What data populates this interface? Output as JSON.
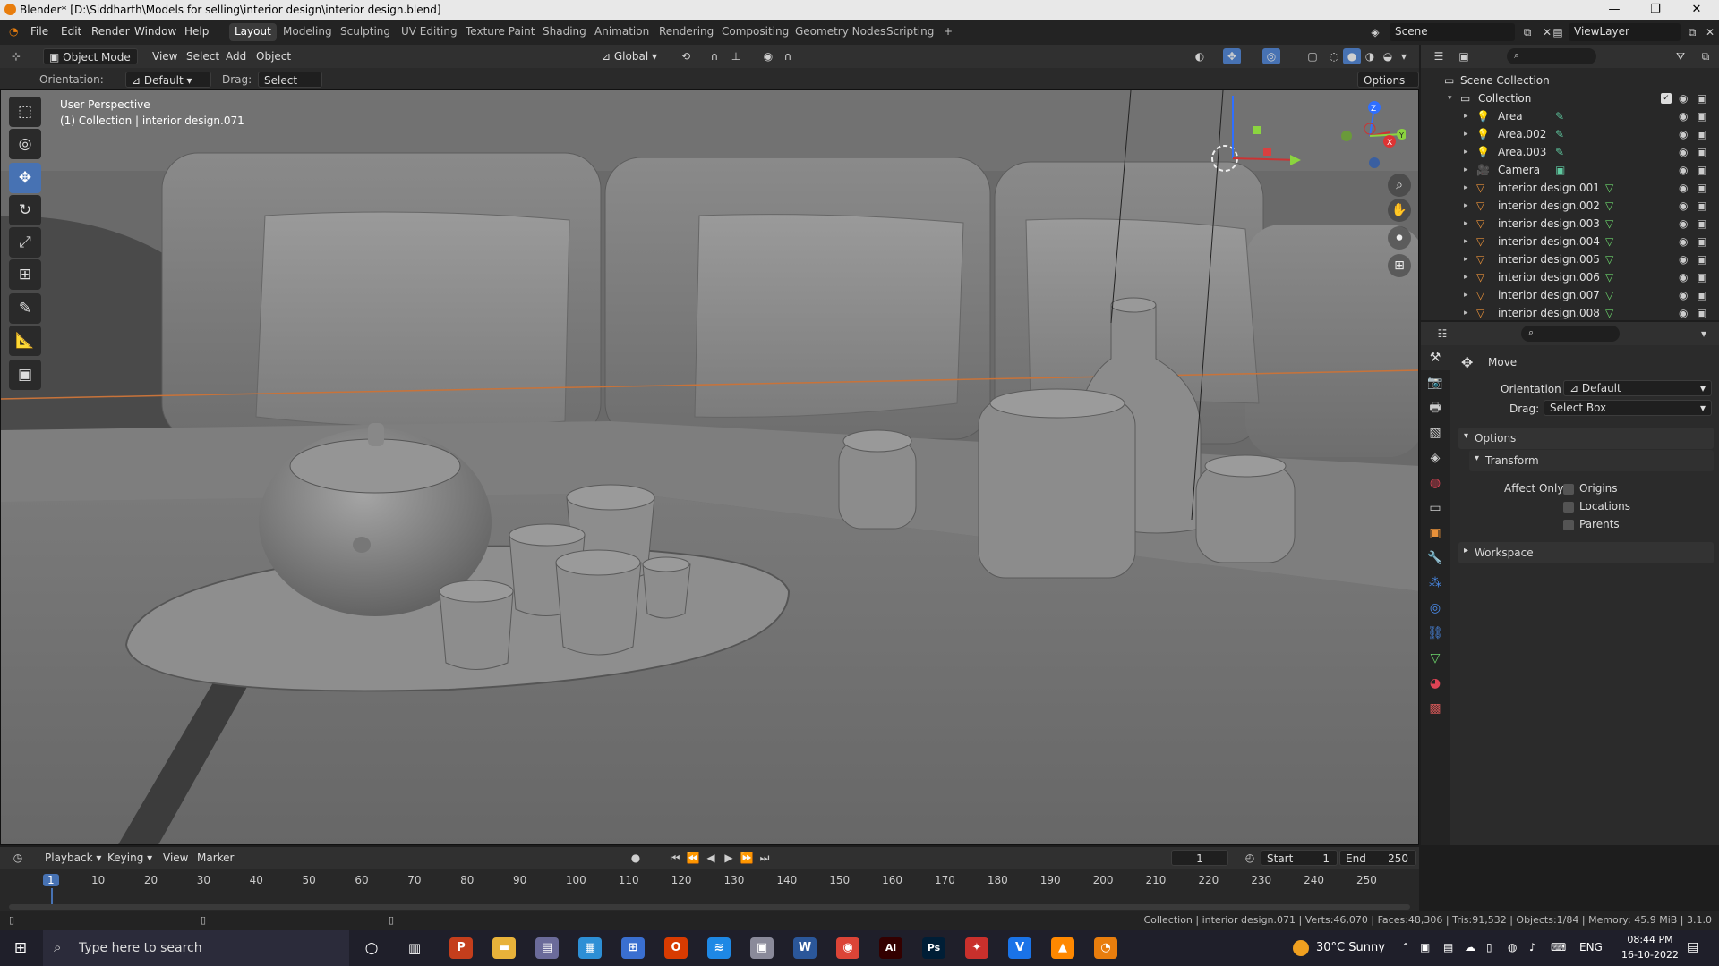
{
  "window": {
    "title": "Blender* [D:\\Siddharth\\Models for selling\\interior design\\interior design.blend]",
    "minimize": "—",
    "restore": "❐",
    "close": "✕"
  },
  "menu": {
    "items": [
      "File",
      "Edit",
      "Render",
      "Window",
      "Help"
    ]
  },
  "workspaces": {
    "tabs": [
      "Layout",
      "Modeling",
      "Sculpting",
      "UV Editing",
      "Texture Paint",
      "Shading",
      "Animation",
      "Rendering",
      "Compositing",
      "Geometry Nodes",
      "Scripting"
    ],
    "active": "Layout",
    "add": "+"
  },
  "scene": {
    "name": "Scene",
    "view_layer": "ViewLayer"
  },
  "viewport_header": {
    "mode": "Object Mode",
    "menus": [
      "View",
      "Select",
      "Add",
      "Object"
    ],
    "transform_orientation": "Global"
  },
  "toolsettings": {
    "orientation_label": "Orientation:",
    "orientation_value": "Default",
    "drag_label": "Drag:",
    "drag_value": "Select Box",
    "options": "Options"
  },
  "viewport": {
    "perspective": "User Perspective",
    "collection_info": "(1) Collection | interior design.071",
    "gizmo": {
      "x": "X",
      "y": "Y",
      "z": "Z"
    }
  },
  "tools": [
    {
      "name": "select-box-tool",
      "glyph": "⬚"
    },
    {
      "name": "cursor-tool",
      "glyph": "◎"
    },
    {
      "name": "move-tool",
      "glyph": "✥"
    },
    {
      "name": "rotate-tool",
      "glyph": "↻"
    },
    {
      "name": "scale-tool",
      "glyph": "⤢"
    },
    {
      "name": "transform-tool",
      "glyph": "⊞"
    },
    {
      "name": "annotate-tool",
      "glyph": "✎"
    },
    {
      "name": "measure-tool",
      "glyph": "📐"
    },
    {
      "name": "add-cube-tool",
      "glyph": "▣"
    }
  ],
  "outliner": {
    "root": "Scene Collection",
    "collection": "Collection",
    "items": [
      {
        "label": "Area",
        "type": "light"
      },
      {
        "label": "Area.002",
        "type": "light"
      },
      {
        "label": "Area.003",
        "type": "light"
      },
      {
        "label": "Camera",
        "type": "camera"
      },
      {
        "label": "interior design.001",
        "type": "mesh"
      },
      {
        "label": "interior design.002",
        "type": "mesh"
      },
      {
        "label": "interior design.003",
        "type": "mesh"
      },
      {
        "label": "interior design.004",
        "type": "mesh"
      },
      {
        "label": "interior design.005",
        "type": "mesh"
      },
      {
        "label": "interior design.006",
        "type": "mesh"
      },
      {
        "label": "interior design.007",
        "type": "mesh"
      },
      {
        "label": "interior design.008",
        "type": "mesh"
      }
    ]
  },
  "properties": {
    "tool_name": "Move",
    "orientation_label": "Orientation",
    "orientation_value": "Default",
    "drag_label": "Drag:",
    "drag_value": "Select Box",
    "options_panel": "Options",
    "transform_panel": "Transform",
    "affect_only_label": "Affect Only",
    "affect_only": [
      "Origins",
      "Locations",
      "Parents"
    ],
    "workspace_panel": "Workspace"
  },
  "timeline": {
    "menus": [
      "Playback",
      "Keying",
      "View",
      "Marker"
    ],
    "current_frame": "1",
    "start_label": "Start",
    "start": "1",
    "end_label": "End",
    "end": "250",
    "ticks": [
      "1",
      "10",
      "20",
      "30",
      "40",
      "50",
      "60",
      "70",
      "80",
      "90",
      "100",
      "110",
      "120",
      "130",
      "140",
      "150",
      "160",
      "170",
      "180",
      "190",
      "200",
      "210",
      "220",
      "230",
      "240",
      "250"
    ]
  },
  "statusbar": {
    "text": "Collection | interior design.071 | Verts:46,070 | Faces:48,306 | Tris:91,532 | Objects:1/84 | Memory: 45.9 MiB | 3.1.0"
  },
  "taskbar": {
    "search_placeholder": "Type here to search",
    "weather": "30°C  Sunny",
    "lang": "ENG",
    "time": "08:44 PM",
    "date": "16-10-2022",
    "apps": [
      {
        "name": "powerpoint-icon",
        "glyph": "P",
        "color": "#c43e1c"
      },
      {
        "name": "file-explorer-icon",
        "glyph": "▬",
        "color": "#e8b23a"
      },
      {
        "name": "app-icon-1",
        "glyph": "▤",
        "color": "#6b6b9a"
      },
      {
        "name": "app-icon-2",
        "glyph": "▦",
        "color": "#2d8fd5"
      },
      {
        "name": "store-icon",
        "glyph": "⊞",
        "color": "#3a6fd0"
      },
      {
        "name": "office-icon",
        "glyph": "O",
        "color": "#d83b01"
      },
      {
        "name": "app-icon-3",
        "glyph": "≋",
        "color": "#1e88e5"
      },
      {
        "name": "app-icon-4",
        "glyph": "▣",
        "color": "#8a8a9a"
      },
      {
        "name": "word-icon",
        "glyph": "W",
        "color": "#2b579a"
      },
      {
        "name": "chrome-icon",
        "glyph": "◉",
        "color": "#db4437"
      },
      {
        "name": "illustrator-icon",
        "glyph": "Ai",
        "color": "#330000"
      },
      {
        "name": "photoshop-icon",
        "glyph": "Ps",
        "color": "#001e36"
      },
      {
        "name": "app-icon-5",
        "glyph": "✦",
        "color": "#c9302c"
      },
      {
        "name": "vectorworks-icon",
        "glyph": "V",
        "color": "#1a73e8"
      },
      {
        "name": "vlc-icon",
        "glyph": "▲",
        "color": "#ff8800"
      },
      {
        "name": "blender-taskbar-icon",
        "glyph": "◔",
        "color": "#e87d0d"
      }
    ]
  },
  "colors": {
    "accent": "#4772b3",
    "viewport_bg": "#6b6b6b",
    "selection_orange": "#e87d0d"
  }
}
